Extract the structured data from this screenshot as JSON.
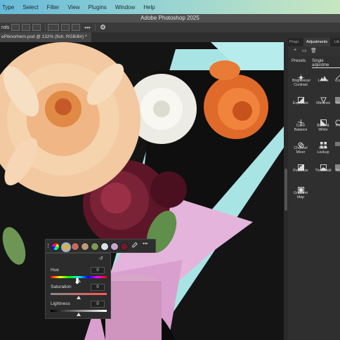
{
  "menu": {
    "items": [
      "Type",
      "Select",
      "Filter",
      "View",
      "Plugins",
      "Window",
      "Help"
    ]
  },
  "window": {
    "title": "Adobe Photoshop 2025"
  },
  "options_bar": {
    "label": "rols",
    "more_glyph": "•••"
  },
  "document": {
    "tab_label": "ePiknorhern.psd @ 132% (fish, RGB/8#) *"
  },
  "panel": {
    "tabs": [
      "Propi",
      "Adjustments",
      "Lib"
    ],
    "subtabs": [
      "Presets",
      "Single adjustme"
    ],
    "adjustments": [
      {
        "label": "Brightness/ Contrast",
        "icon": "brightness-contrast-icon"
      },
      {
        "label": "Levels",
        "icon": "levels-icon"
      },
      {
        "label": "Cu",
        "icon": "curves-icon"
      },
      {
        "label": "Exposure",
        "icon": "exposure-icon"
      },
      {
        "label": "Vibrance",
        "icon": "vibrance-icon"
      },
      {
        "label": "Sa",
        "icon": "saturation-icon"
      },
      {
        "label": "Color Balance",
        "icon": "color-balance-icon"
      },
      {
        "label": "Black & White",
        "icon": "black-white-icon"
      },
      {
        "label": "Ph",
        "icon": "photo-filter-icon"
      },
      {
        "label": "Channel Mixer",
        "icon": "channel-mixer-icon"
      },
      {
        "label": "Color Lookup",
        "icon": "color-lookup-icon"
      },
      {
        "label": "",
        "icon": "invert-icon"
      },
      {
        "label": "Posterize",
        "icon": "posterize-icon"
      },
      {
        "label": "Threshold",
        "icon": "threshold-icon"
      },
      {
        "label": "Se",
        "icon": "selective-color-icon"
      },
      {
        "label": "Gradient Map",
        "icon": "gradient-map-icon"
      }
    ]
  },
  "hsl": {
    "hue_label": "Hue",
    "hue_value": "0",
    "saturation_label": "Saturation",
    "saturation_value": "0",
    "lightness_label": "Lightness",
    "lightness_value": "0"
  },
  "swatch_colors": [
    "#d9b24c",
    "#c46a5f",
    "#b89a76",
    "#7a9a58",
    "#d6e2e6",
    "#c7a3c9",
    "#6a1c2c"
  ]
}
